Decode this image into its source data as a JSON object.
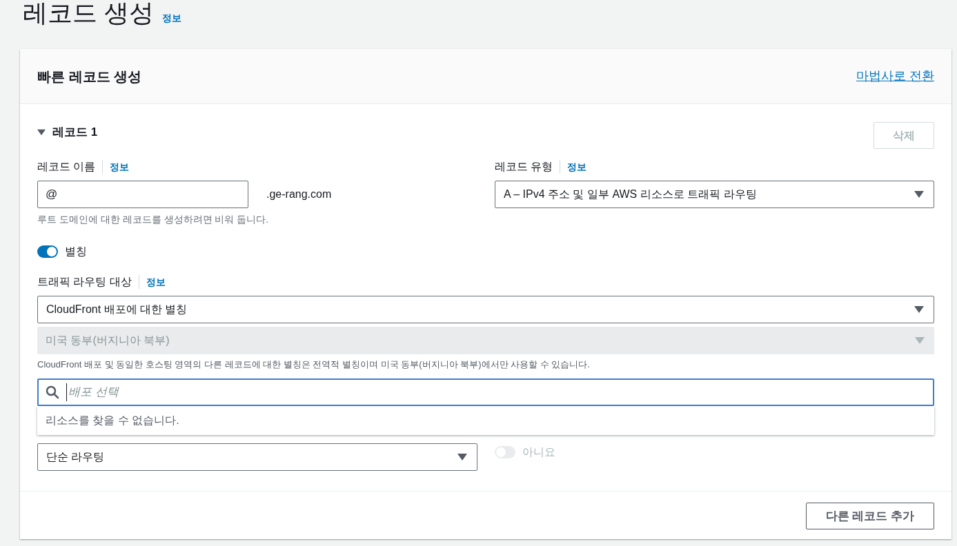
{
  "page": {
    "title": "레코드 생성",
    "info_link": "정보"
  },
  "card": {
    "title": "빠른 레코드 생성",
    "wizard_link": "마법사로 전환"
  },
  "record": {
    "title": "레코드 1",
    "expanded": true,
    "delete_button": {
      "label": "삭제",
      "disabled": true
    }
  },
  "record_name": {
    "label": "레코드 이름",
    "info_link": "정보",
    "value": "@",
    "suffix": ".ge-rang.com",
    "hint": "루트 도메인에 대한 레코드를 생성하려면 비워 둡니다."
  },
  "record_type": {
    "label": "레코드 유형",
    "info_link": "정보",
    "value": "A – IPv4 주소 및 일부 AWS 리소스로 트래픽 라우팅"
  },
  "alias": {
    "label": "별칭",
    "on": true
  },
  "routing_target": {
    "label": "트래픽 라우팅 대상",
    "info_link": "정보",
    "value": "CloudFront 배포에 대한 별칭",
    "region": {
      "value": "미국 동부(버지니아 북부)",
      "disabled": true
    },
    "hint": "CloudFront 배포 및 동일한 호스팅 영역의 다른 레코드에 대한 별칭은 전역적 별칭이며 미국 동부(버지니아 북부)에서만 사용할 수 있습니다.",
    "search": {
      "placeholder": "배포 선택"
    },
    "empty_message": "리소스를 찾을 수 없습니다."
  },
  "routing_policy": {
    "value": "단순 라우팅"
  },
  "health": {
    "label": "아니요",
    "on": false,
    "disabled": true
  },
  "add_button": {
    "label": "다른 레코드 추가"
  }
}
